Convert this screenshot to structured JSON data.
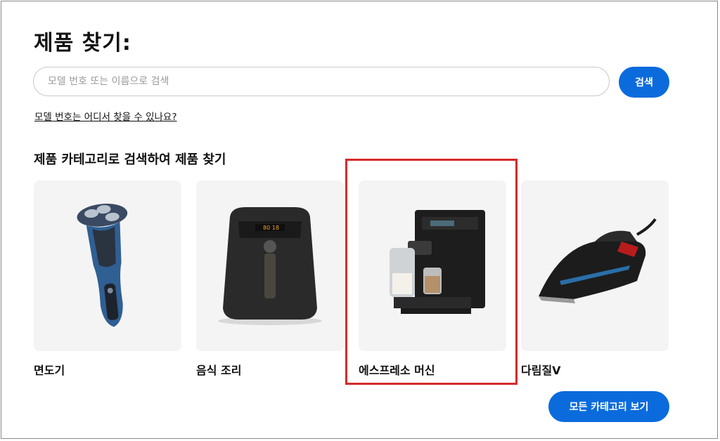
{
  "page_title": "제품 찾기:",
  "search": {
    "placeholder": "모델 번호 또는 이름으로 검색",
    "value": "",
    "button_label": "검색"
  },
  "help_link": "모델 번호는 어디서 찾을 수 있나요?",
  "categories_heading": "제품 카테고리로 검색하여 제품 찾기",
  "categories": [
    {
      "label": "면도기",
      "icon": "shaver-image"
    },
    {
      "label": "음식 조리",
      "icon": "airfryer-image"
    },
    {
      "label": "에스프레소 머신",
      "icon": "espresso-machine-image",
      "highlighted": true
    },
    {
      "label": "다림질V",
      "icon": "steam-iron-image"
    }
  ],
  "all_categories_button": "모든 카테고리 보기",
  "colors": {
    "accent": "#0b6bdc",
    "highlight_border": "#d62a2a",
    "card_bg": "#f4f4f4"
  }
}
